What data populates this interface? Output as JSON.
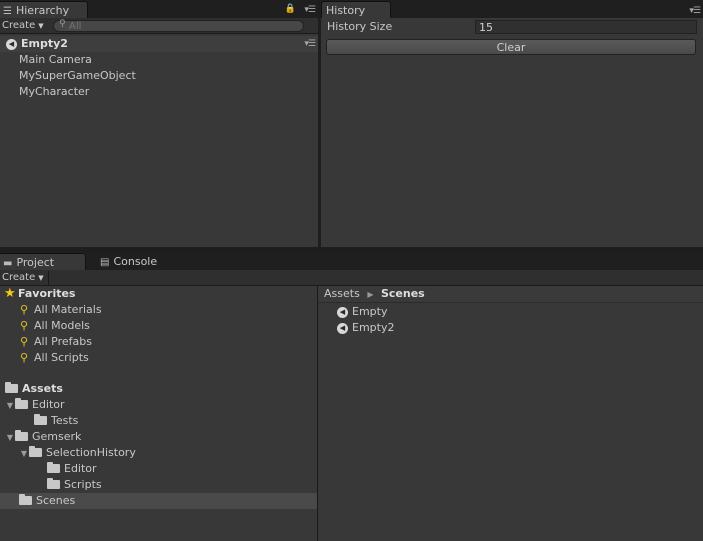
{
  "hierarchy": {
    "tab_label": "Hierarchy",
    "create_label": "Create",
    "search_placeholder": "All",
    "scene_name": "Empty2",
    "items": [
      "Main Camera",
      "MySuperGameObject",
      "MyCharacter"
    ]
  },
  "history": {
    "tab_label": "History",
    "size_label": "History Size",
    "size_value": "15",
    "clear_label": "Clear"
  },
  "project": {
    "tab_label": "Project",
    "console_tab_label": "Console",
    "create_label": "Create",
    "favorites_label": "Favorites",
    "favorites": [
      "All Materials",
      "All Models",
      "All Prefabs",
      "All Scripts"
    ],
    "assets_label": "Assets",
    "tree": {
      "editor": "Editor",
      "tests": "Tests",
      "gemserk": "Gemserk",
      "selection_history": "SelectionHistory",
      "sh_editor": "Editor",
      "sh_scripts": "Scripts",
      "scenes": "Scenes"
    },
    "breadcrumb": {
      "root": "Assets",
      "current": "Scenes"
    },
    "scene_files": [
      "Empty",
      "Empty2"
    ]
  },
  "colors": {
    "panel": "#383838",
    "selection": "#4a4a4a",
    "favorites_star": "#f5c518"
  }
}
